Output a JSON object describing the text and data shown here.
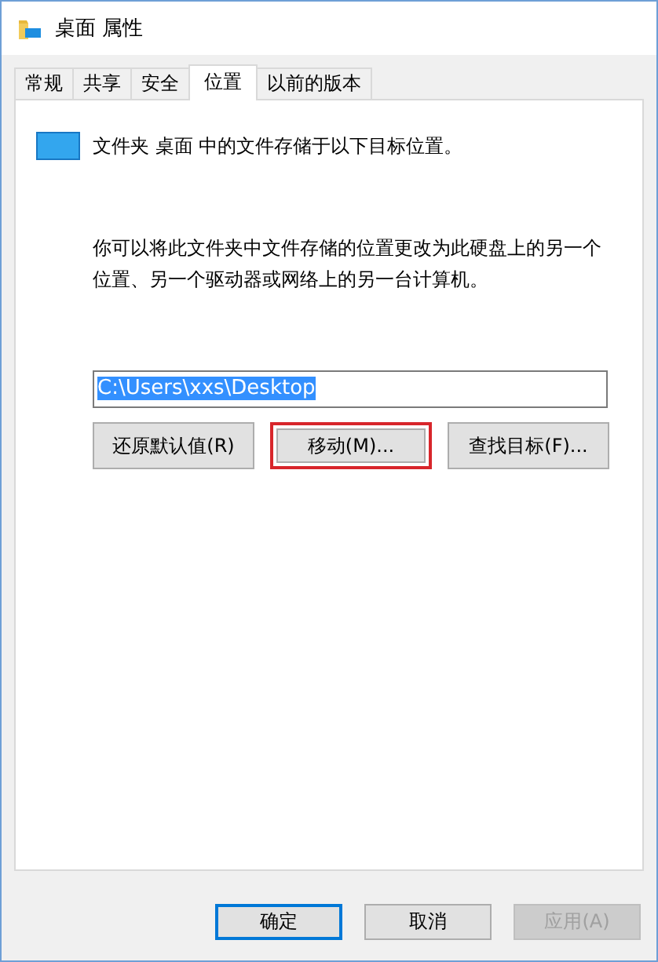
{
  "window": {
    "title": "桌面 属性"
  },
  "tabs": [
    {
      "label": "常规",
      "selected": false
    },
    {
      "label": "共享",
      "selected": false
    },
    {
      "label": "安全",
      "selected": false
    },
    {
      "label": "位置",
      "selected": true
    },
    {
      "label": "以前的版本",
      "selected": false
    }
  ],
  "location": {
    "heading": "文件夹 桌面 中的文件存储于以下目标位置。",
    "description": "你可以将此文件夹中文件存储的位置更改为此硬盘上的另一个位置、另一个驱动器或网络上的另一台计算机。",
    "path": {
      "value": "C:\\Users\\xxs\\Desktop",
      "selected": true
    },
    "buttons": [
      {
        "label": "还原默认值(R)",
        "highlighted": false
      },
      {
        "label": "移动(M)...",
        "highlighted": true
      },
      {
        "label": "查找目标(F)...",
        "highlighted": false
      }
    ]
  },
  "dialog_buttons": [
    {
      "label": "确定",
      "default": true,
      "disabled": false
    },
    {
      "label": "取消",
      "default": false,
      "disabled": false
    },
    {
      "label": "应用(A)",
      "default": false,
      "disabled": true
    }
  ]
}
